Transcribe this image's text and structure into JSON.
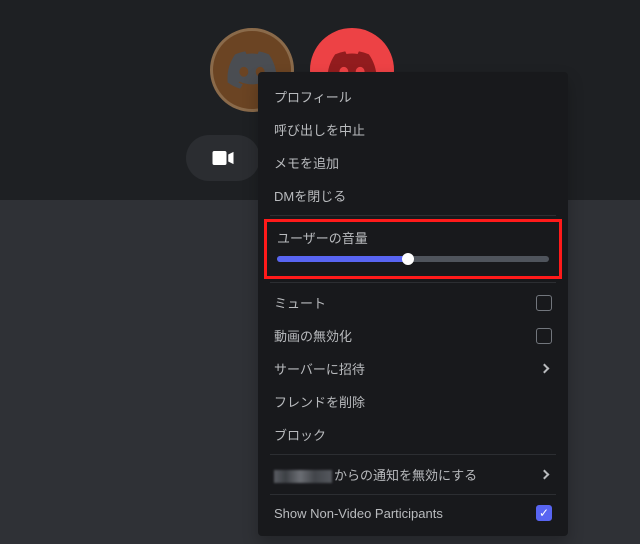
{
  "avatars": {
    "primary_color": "#6b4423",
    "secondary_color": "#ED4245"
  },
  "menu": {
    "profile": "プロフィール",
    "cancel_call": "呼び出しを中止",
    "add_note": "メモを追加",
    "close_dm": "DMを閉じる",
    "user_volume": "ユーザーの音量",
    "volume_percent": 48,
    "mute": "ミュート",
    "disable_video": "動画の無効化",
    "invite_server": "サーバーに招待",
    "remove_friend": "フレンドを削除",
    "block": "ブロック",
    "notifications_suffix": "からの通知を無効にする",
    "show_nonvideo": "Show Non-Video Participants",
    "show_nonvideo_checked": true
  }
}
